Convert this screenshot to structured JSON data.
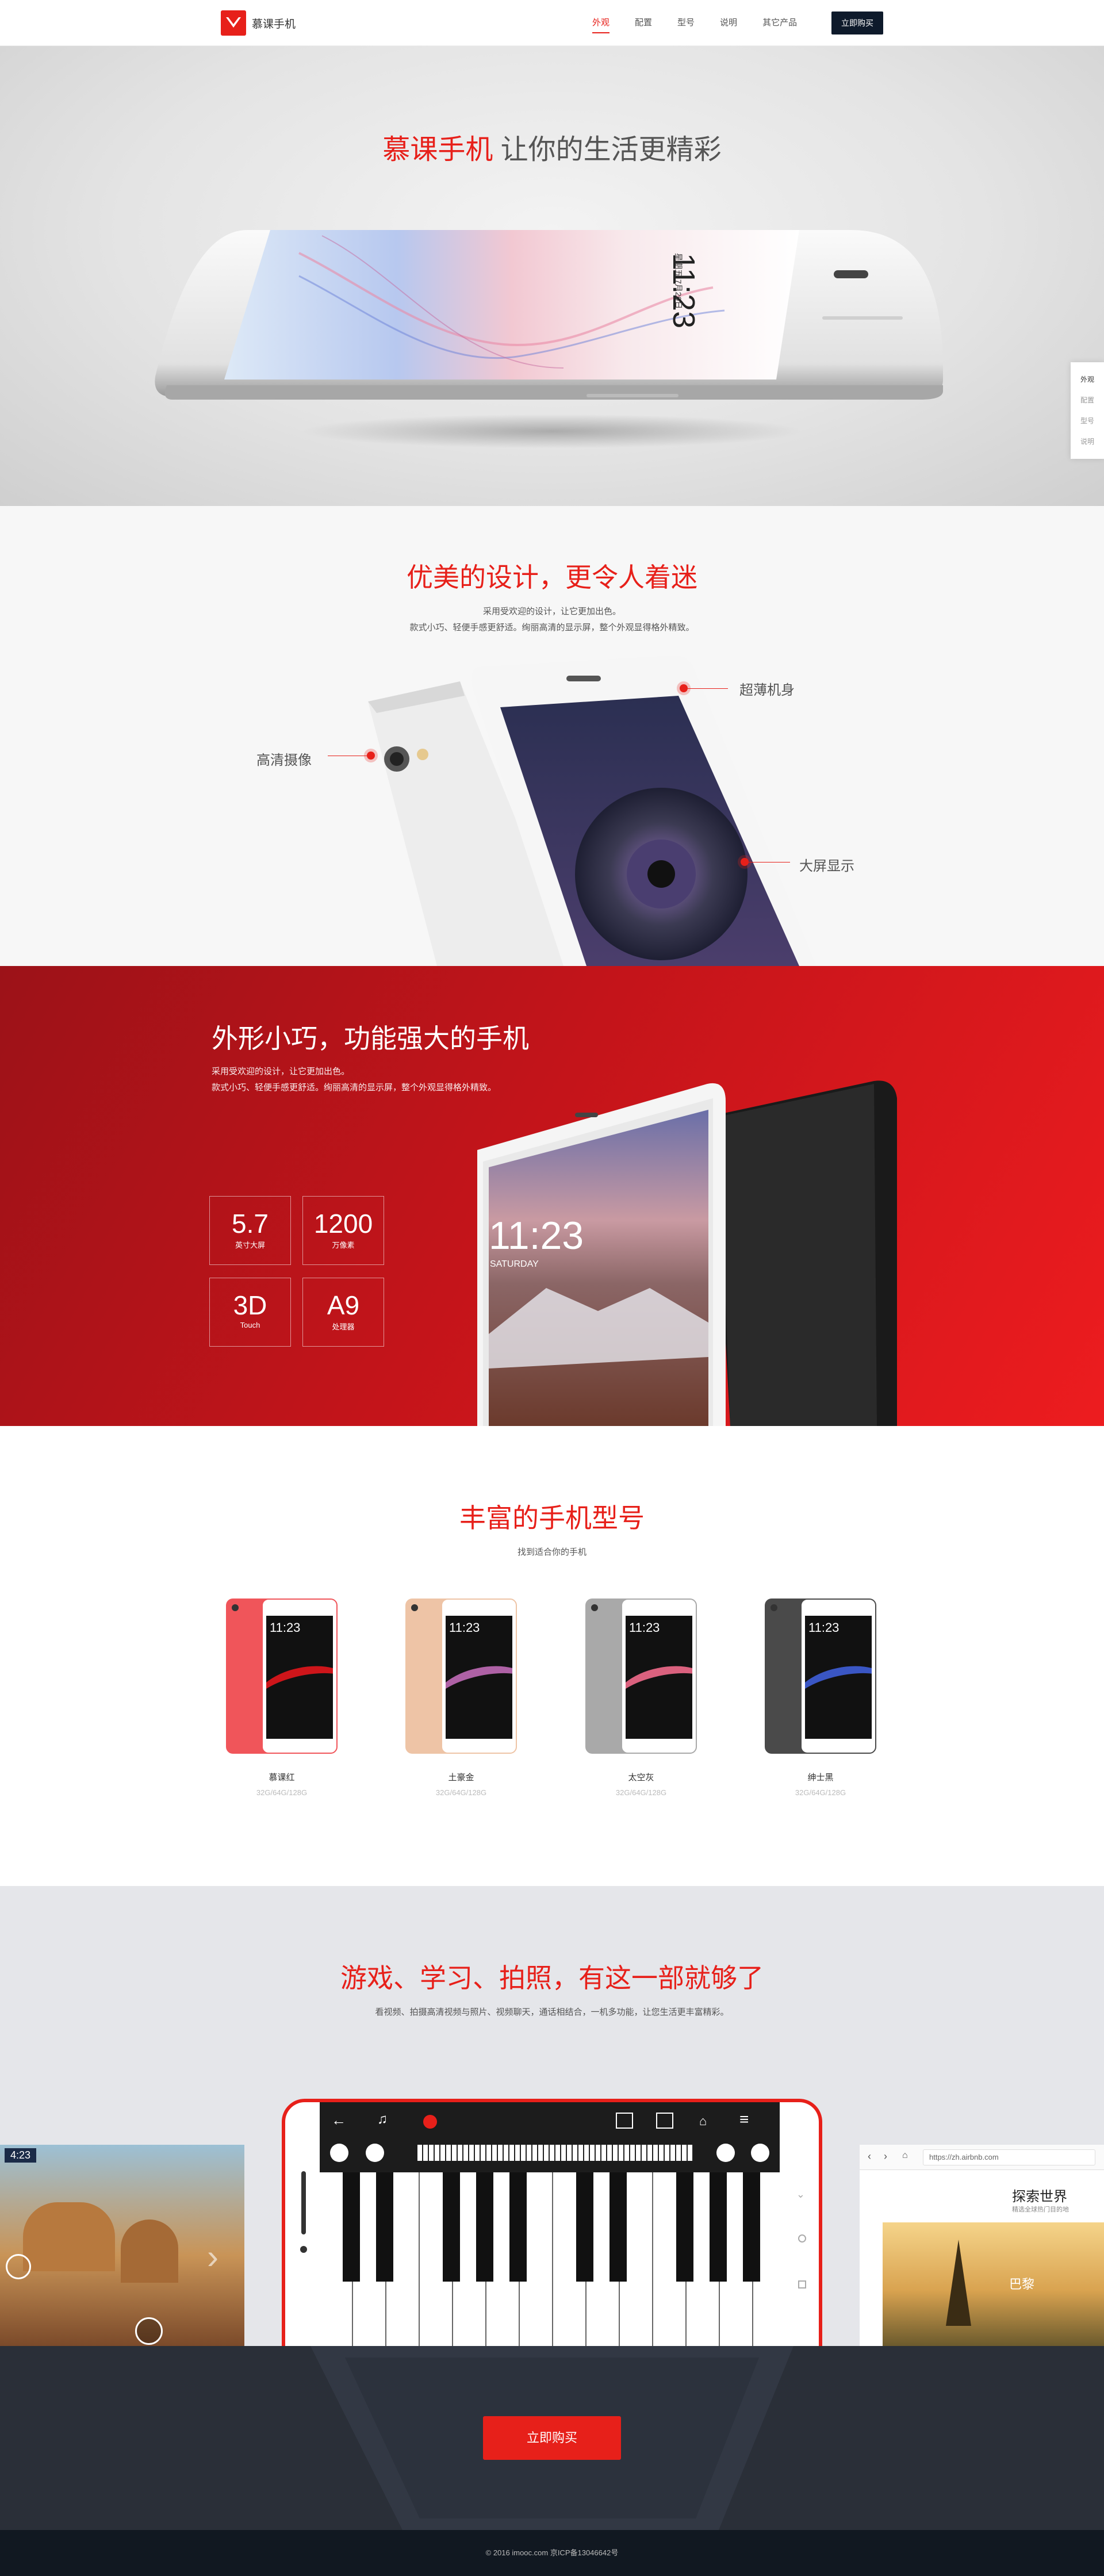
{
  "nav": {
    "brand": "慕课手机",
    "links": [
      "外观",
      "配置",
      "型号",
      "说明",
      "其它产品"
    ],
    "buy": "立即购买"
  },
  "side_nav": [
    "外观",
    "配置",
    "型号",
    "说明"
  ],
  "hero": {
    "title_red": "慕课手机",
    "title_rest": " 让你的生活更精彩",
    "phone_time": "11:23",
    "phone_date": "星期五 7月20日"
  },
  "design": {
    "title": "优美的设计，更令人着迷",
    "desc1": "采用受欢迎的设计，让它更加出色。",
    "desc2": "款式小巧、轻便手感更舒适。绚丽高清的显示屏，整个外观显得格外精致。",
    "callout_thin": "超薄机身",
    "callout_camera": "高清摄像",
    "callout_screen": "大屏显示"
  },
  "spec": {
    "title": "外形小巧，功能强大的手机",
    "desc1": "采用受欢迎的设计，让它更加出色。",
    "desc2": "款式小巧、轻便手感更舒适。绚丽高清的显示屏，整个外观显得格外精致。",
    "boxes": [
      {
        "value": "5.7",
        "label": "英寸大屏"
      },
      {
        "value": "1200",
        "label": "万像素"
      },
      {
        "value": "3D",
        "label": "Touch"
      },
      {
        "value": "A9",
        "label": "处理器"
      }
    ],
    "phone_time": "11:23",
    "phone_day": "SATURDAY"
  },
  "models": {
    "title": "丰富的手机型号",
    "desc": "找到适合你的手机",
    "items": [
      {
        "name": "慕课红",
        "spec": "32G/64G/128G",
        "color": "#f0555a",
        "wave": "#e3161c",
        "time": "11:23"
      },
      {
        "name": "土豪金",
        "spec": "32G/64G/128G",
        "color": "#eec4a6",
        "wave": "#c06ab6",
        "time": "11:23"
      },
      {
        "name": "太空灰",
        "spec": "32G/64G/128G",
        "color": "#a9a9a9",
        "wave": "#f06a8a",
        "time": "11:23"
      },
      {
        "name": "绅士黑",
        "spec": "32G/64G/128G",
        "color": "#4a4a4a",
        "wave": "#3f5ed8",
        "time": "11:23"
      }
    ]
  },
  "apps": {
    "title": "游戏、学习、拍照，有这一部就够了",
    "desc": "看视频、拍摄高清视频与照片、视频聊天，通话相结合，一机多功能，让您生活更丰富精彩。",
    "game_time": "4:23",
    "browser_url": "https://zh.airbnb.com",
    "browser_heading": "探索世界",
    "browser_sub": "精选全球热门目的地",
    "browser_city": "巴黎"
  },
  "buy": {
    "label": "立即购买"
  },
  "footer": {
    "text": "© 2016 imooc.com  京ICP备13046642号"
  },
  "colors": {
    "accent": "#e7201a",
    "dark": "#2a2f38"
  }
}
